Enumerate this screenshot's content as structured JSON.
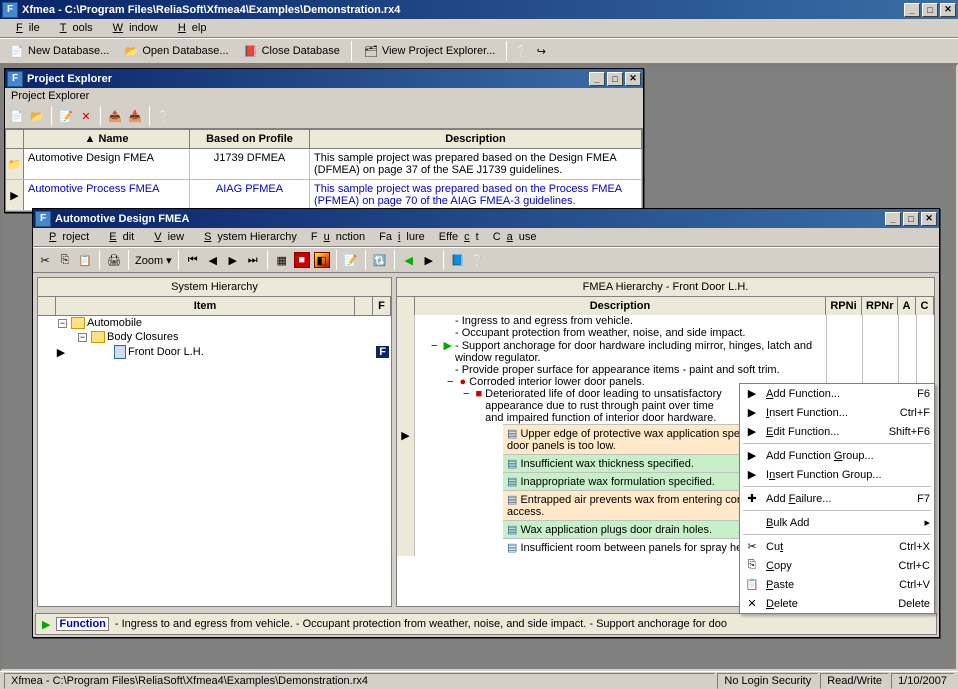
{
  "app": {
    "title": "Xfmea - C:\\Program Files\\ReliaSoft\\Xfmea4\\Examples\\Demonstration.rx4",
    "menus": [
      "File",
      "Tools",
      "Window",
      "Help"
    ],
    "toolbar": [
      {
        "icon": "📄",
        "label": "New Database..."
      },
      {
        "icon": "📂",
        "label": "Open Database..."
      },
      {
        "icon": "📕",
        "label": "Close Database"
      },
      {
        "icon": "🗂",
        "label": "View Project Explorer..."
      }
    ]
  },
  "project_explorer": {
    "title": "Project Explorer",
    "breadcrumb": "Project Explorer",
    "columns": [
      "Name",
      "Based on Profile",
      "Description"
    ],
    "rows": [
      {
        "name": "Automotive Design FMEA",
        "profile": "J1739 DFMEA",
        "desc": "This sample project was prepared based on the Design FMEA (DFMEA) on page 37 of the SAE J1739 guidelines.",
        "sel": false
      },
      {
        "name": "Automotive Process FMEA",
        "profile": "AIAG PFMEA",
        "desc": "This sample project was prepared based on the Process FMEA (PFMEA) on page 70 of the AIAG FMEA-3 guidelines.",
        "sel": true
      }
    ]
  },
  "design_window": {
    "title": "Automotive Design FMEA",
    "menus": [
      "Project",
      "Edit",
      "View",
      "System Hierarchy",
      "Function",
      "Failure",
      "Effect",
      "Cause"
    ],
    "zoom_label": "Zoom",
    "left": {
      "title": "System Hierarchy",
      "item_col": "Item",
      "flag_cols": [
        "",
        "F"
      ],
      "tree": [
        {
          "level": 0,
          "label": "Automobile",
          "exp": "-",
          "icon": "folder"
        },
        {
          "level": 1,
          "label": "Body Closures",
          "exp": "-",
          "icon": "folder"
        },
        {
          "level": 2,
          "label": "Front Door L.H.",
          "icon": "doc",
          "selected": true,
          "f": "F"
        }
      ]
    },
    "right": {
      "title": "FMEA Hierarchy - Front Door L.H.",
      "columns": [
        "Description",
        "RPNi",
        "RPNr",
        "A",
        "C"
      ],
      "functions": [
        "- Ingress to and egress from vehicle.",
        "- Occupant protection from weather, noise, and side impact.",
        "- Support anchorage for door hardware including mirror, hinges, latch and window regulator.",
        "- Provide proper surface for appearance items - paint and soft trim."
      ],
      "failure": "Corroded interior lower door panels.",
      "effect": "Deteriorated life of door leading to unsatisfactory appearance due to rust through paint over time and impaired function of interior door hardware.",
      "causes": [
        {
          "t": "Upper edge of protective wax application specified for inner door panels is too low.",
          "h": "h1"
        },
        {
          "t": "Insufficient wax thickness specified.",
          "h": "h2"
        },
        {
          "t": "Inappropriate wax formulation specified.",
          "h": "h2"
        },
        {
          "t": "Entrapped air prevents wax from entering corner/edge access.",
          "h": "h1"
        },
        {
          "t": "Wax application plugs door drain holes.",
          "h": "h2"
        },
        {
          "t": "Insufficient room between panels for spray head access.",
          "h": ""
        }
      ]
    },
    "functionbar": "- Ingress to and egress from vehicle.  - Occupant protection from weather, noise, and side impact.  - Support anchorage for doo",
    "functionbar_label": "Function"
  },
  "context_menu": [
    {
      "icon": "▶",
      "label": "Add Function...",
      "sc": "F6",
      "u": "A"
    },
    {
      "icon": "▶",
      "label": "Insert Function...",
      "sc": "Ctrl+F",
      "u": "I"
    },
    {
      "icon": "▶",
      "label": "Edit Function...",
      "sc": "Shift+F6",
      "u": "E"
    },
    {
      "sep": true
    },
    {
      "icon": "▶",
      "label": "Add Function Group...",
      "u": "G"
    },
    {
      "icon": "▶",
      "label": "Insert Function Group...",
      "u": "n"
    },
    {
      "sep": true
    },
    {
      "icon": "✚",
      "label": "Add Failure...",
      "sc": "F7",
      "u": "F"
    },
    {
      "sep": true
    },
    {
      "icon": "",
      "label": "Bulk Add",
      "sub": true,
      "u": "B"
    },
    {
      "sep": true
    },
    {
      "icon": "✂",
      "label": "Cut",
      "sc": "Ctrl+X",
      "u": "t"
    },
    {
      "icon": "⎘",
      "label": "Copy",
      "sc": "Ctrl+C",
      "u": "C"
    },
    {
      "icon": "📋",
      "label": "Paste",
      "sc": "Ctrl+V",
      "u": "P"
    },
    {
      "icon": "✕",
      "label": "Delete",
      "sc": "Delete",
      "u": "D"
    }
  ],
  "statusbar": {
    "path": "Xfmea - C:\\Program Files\\ReliaSoft\\Xfmea4\\Examples\\Demonstration.rx4",
    "login": "No Login Security",
    "rw": "Read/Write",
    "date": "1/10/2007"
  }
}
